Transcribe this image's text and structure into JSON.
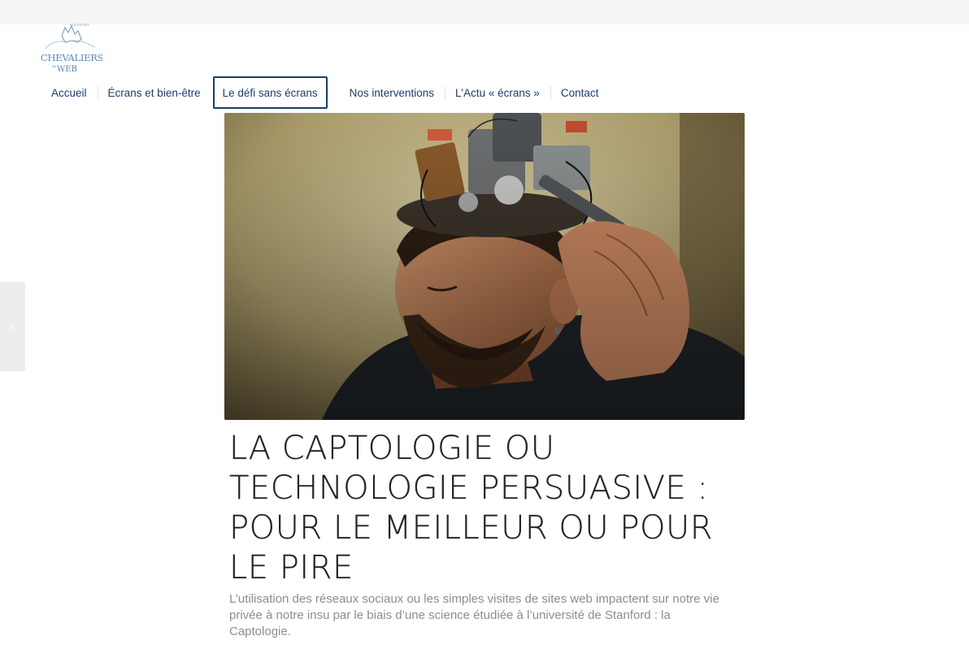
{
  "site": {
    "logo_text": "Chevaliers du Web"
  },
  "nav": {
    "items": [
      {
        "label": "Accueil"
      },
      {
        "label": "Écrans et bien-être"
      },
      {
        "label": "Le défi sans écrans",
        "active": true
      },
      {
        "label": "Nos interventions"
      },
      {
        "label": "L'Actu « écrans »"
      },
      {
        "label": "Contact"
      }
    ]
  },
  "slider": {
    "prev_icon": "chevron-left-icon",
    "prev_glyph": "‹"
  },
  "article": {
    "image_alt": "Homme barbu avec un mécanisme électronique à la place du sommet du crâne",
    "title": "La Captologie ou technologie persuasive : pour le meilleur ou pour le pire",
    "excerpt": "L’utilisation des réseaux sociaux ou les simples visites de sites web impactent sur notre vie privée à notre insu par le biais d’une science étudiée à l’université de Stanford : la Captologie."
  },
  "colors": {
    "nav_text": "#1b3e6a",
    "title_text": "#222222",
    "excerpt_text": "#8d8d8d",
    "topbar_bg": "#f5f5f5"
  }
}
